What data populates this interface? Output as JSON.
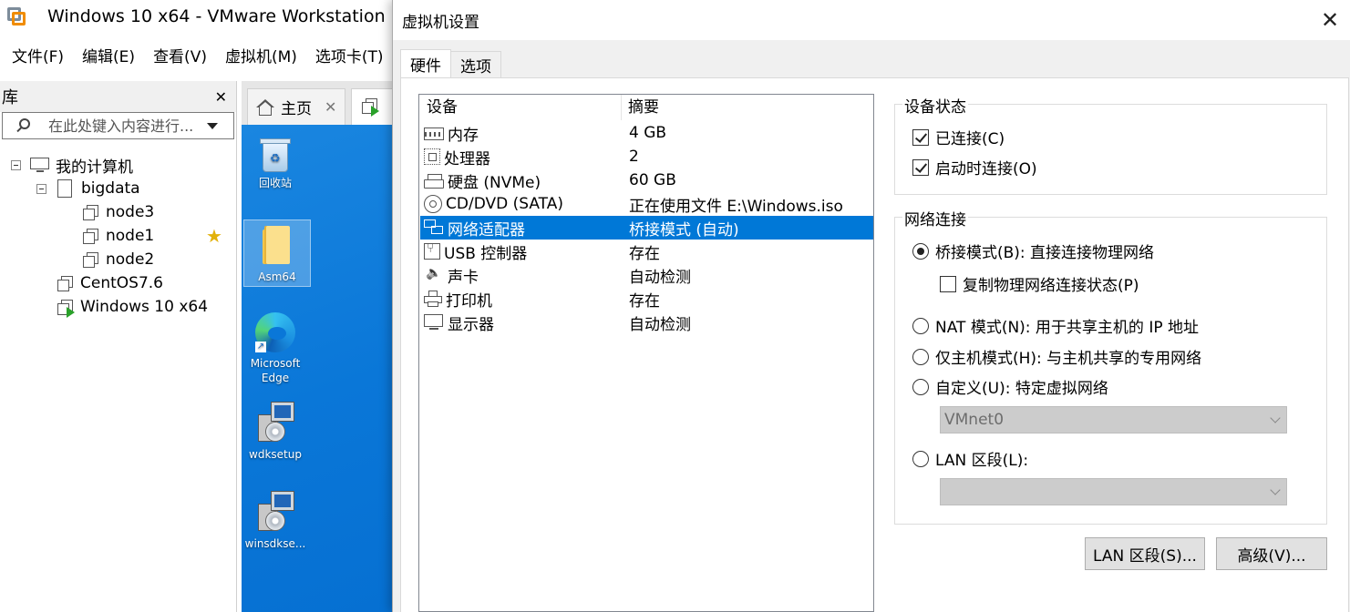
{
  "app": {
    "title": "Windows 10 x64 - VMware Workstation",
    "menu": [
      "文件(F)",
      "编辑(E)",
      "查看(V)",
      "虚拟机(M)",
      "选项卡(T)"
    ]
  },
  "library": {
    "title": "库",
    "close": "✕",
    "search_placeholder": "在此处键入内容进行...",
    "tree": {
      "root": "我的计算机",
      "folder": "bigdata",
      "nodes": [
        "node3",
        "node1",
        "node2"
      ],
      "vms": [
        "CentOS7.6",
        "Windows 10 x64"
      ]
    }
  },
  "tabs": {
    "home": "主页",
    "home_close": "✕"
  },
  "desktop": {
    "items": [
      "回收站",
      "Asm64",
      "Microsoft Edge",
      "wdksetup",
      "winsdkse..."
    ]
  },
  "dialog": {
    "title": "虚拟机设置",
    "close": "✕",
    "tabs": [
      "硬件",
      "选项"
    ],
    "devices": {
      "col_device": "设备",
      "col_summary": "摘要",
      "rows": [
        {
          "icon": "memory-icon",
          "name": "内存",
          "summary": "4 GB"
        },
        {
          "icon": "processor-icon",
          "name": "处理器",
          "summary": "2"
        },
        {
          "icon": "hard-disk-icon",
          "name": "硬盘 (NVMe)",
          "summary": "60 GB"
        },
        {
          "icon": "cd-dvd-icon",
          "name": "CD/DVD (SATA)",
          "summary": "正在使用文件 E:\\Windows.iso"
        },
        {
          "icon": "network-adapter-icon",
          "name": "网络适配器",
          "summary": "桥接模式 (自动)"
        },
        {
          "icon": "usb-controller-icon",
          "name": "USB 控制器",
          "summary": "存在"
        },
        {
          "icon": "sound-card-icon",
          "name": "声卡",
          "summary": "自动检测"
        },
        {
          "icon": "printer-icon",
          "name": "打印机",
          "summary": "存在"
        },
        {
          "icon": "display-icon",
          "name": "显示器",
          "summary": "自动检测"
        }
      ],
      "selected_index": 4
    },
    "device_status": {
      "title": "设备状态",
      "connected": "已连接(C)",
      "connect_at_power_on": "启动时连接(O)"
    },
    "network": {
      "title": "网络连接",
      "bridged": "桥接模式(B): 直接连接物理网络",
      "replicate": "复制物理网络连接状态(P)",
      "nat": "NAT 模式(N): 用于共享主机的 IP 地址",
      "host_only": "仅主机模式(H): 与主机共享的专用网络",
      "custom": "自定义(U): 特定虚拟网络",
      "custom_value": "VMnet0",
      "lan_segment": "LAN 区段(L):",
      "lan_value": ""
    },
    "buttons": {
      "lan_segments": "LAN 区段(S)...",
      "advanced": "高级(V)..."
    }
  }
}
